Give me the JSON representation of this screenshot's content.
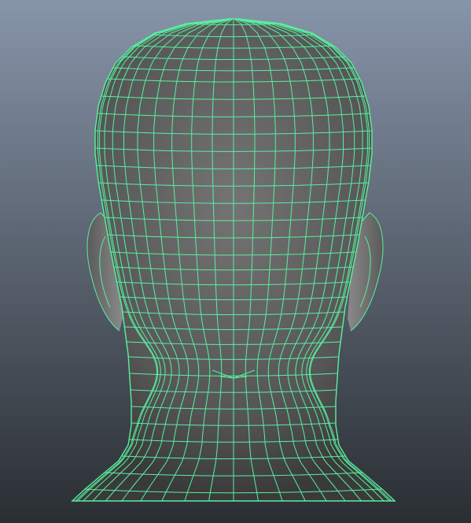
{
  "viewport": {
    "background_top": "#8795a9",
    "background_bottom": "#2a2e33",
    "mesh_fill_light": "#747474",
    "mesh_fill_dark": "#3a3a3a",
    "wireframe_color": "#58f0a0",
    "object": "head-mesh-back-view",
    "display_mode": "wireframe-on-shaded"
  }
}
